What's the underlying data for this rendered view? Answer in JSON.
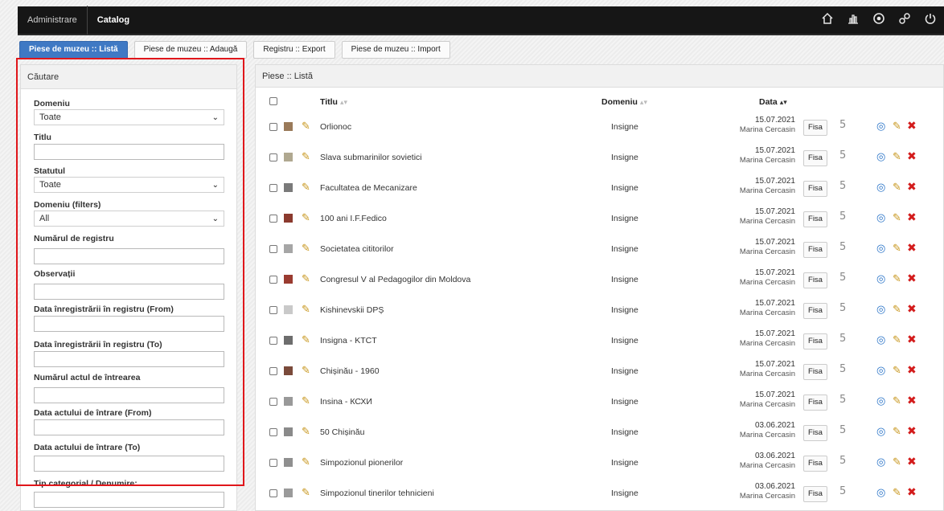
{
  "topbar": {
    "items": [
      "Administrare",
      "Catalog"
    ],
    "icons": [
      "home-icon",
      "stats-icon",
      "settings-icon",
      "link-icon",
      "power-icon"
    ]
  },
  "tabs": [
    {
      "label": "Piese de muzeu :: Listă",
      "active": true
    },
    {
      "label": "Piese de muzeu :: Adaugă",
      "active": false
    },
    {
      "label": "Registru :: Export",
      "active": false
    },
    {
      "label": "Piese de muzeu :: Import",
      "active": false
    }
  ],
  "search": {
    "title": "Căutare",
    "fields": {
      "domeniu": {
        "label": "Domeniu",
        "value": "Toate"
      },
      "titlu": {
        "label": "Titlu",
        "value": ""
      },
      "statutul": {
        "label": "Statutul",
        "value": "Toate"
      },
      "domeniu_filters": {
        "label": "Domeniu (filters)",
        "value": "All"
      },
      "numar_registru": {
        "label": "Numărul de registru",
        "value": ""
      },
      "observatii": {
        "label": "Observații",
        "value": ""
      },
      "data_reg_from": {
        "label": "Data înregistrării în registru (From)",
        "value": ""
      },
      "data_reg_to": {
        "label": "Data înregistrării în registru (To)",
        "value": ""
      },
      "numar_act": {
        "label": "Numărul actul de întrearea",
        "value": ""
      },
      "data_act_from": {
        "label": "Data actului de întrare (From)",
        "value": ""
      },
      "data_act_to": {
        "label": "Data actului de întrare (To)",
        "value": ""
      },
      "tip_categorial": {
        "label": "Tip categorial / Denumire:",
        "value": ""
      }
    }
  },
  "list": {
    "title": "Piese :: Listă",
    "columns": {
      "title": "Titlu",
      "domain": "Domeniu",
      "date": "Data"
    },
    "fisa_label": "Fisa",
    "rows": [
      {
        "title": "Orlionoc",
        "domain": "Insigne",
        "date": "15.07.2021",
        "user": "Marina Cercasin",
        "thumb": "#9a7a5a"
      },
      {
        "title": "Slava submarinilor sovietici",
        "domain": "Insigne",
        "date": "15.07.2021",
        "user": "Marina Cercasin",
        "thumb": "#b0a890"
      },
      {
        "title": "Facultatea de Mecanizare",
        "domain": "Insigne",
        "date": "15.07.2021",
        "user": "Marina Cercasin",
        "thumb": "#7a7a7a"
      },
      {
        "title": "100 ani I.F.Fedico",
        "domain": "Insigne",
        "date": "15.07.2021",
        "user": "Marina Cercasin",
        "thumb": "#8b3a2e"
      },
      {
        "title": "Societatea cititorilor",
        "domain": "Insigne",
        "date": "15.07.2021",
        "user": "Marina Cercasin",
        "thumb": "#a6a6a6"
      },
      {
        "title": "Congresul V al Pedagogilor din Moldova",
        "domain": "Insigne",
        "date": "15.07.2021",
        "user": "Marina Cercasin",
        "thumb": "#9a3b30"
      },
      {
        "title": "Kishinevskii DPȘ",
        "domain": "Insigne",
        "date": "15.07.2021",
        "user": "Marina Cercasin",
        "thumb": "#c9c9c9"
      },
      {
        "title": "Insigna - KTCT",
        "domain": "Insigne",
        "date": "15.07.2021",
        "user": "Marina Cercasin",
        "thumb": "#6d6d6d"
      },
      {
        "title": "Chișinău - 1960",
        "domain": "Insigne",
        "date": "15.07.2021",
        "user": "Marina Cercasin",
        "thumb": "#7a4a3a"
      },
      {
        "title": "Insina - КСХИ",
        "domain": "Insigne",
        "date": "15.07.2021",
        "user": "Marina Cercasin",
        "thumb": "#999999"
      },
      {
        "title": "50 Chișinău",
        "domain": "Insigne",
        "date": "03.06.2021",
        "user": "Marina Cercasin",
        "thumb": "#8a8a8a"
      },
      {
        "title": "Simpozionul pionerilor",
        "domain": "Insigne",
        "date": "03.06.2021",
        "user": "Marina Cercasin",
        "thumb": "#8f8f8f"
      },
      {
        "title": "Simpozionul tinerilor tehnicieni",
        "domain": "Insigne",
        "date": "03.06.2021",
        "user": "Marina Cercasin",
        "thumb": "#9a9a9a"
      }
    ]
  },
  "colors": {
    "accent": "#3f79c4",
    "highlight": "#e0161b",
    "delete": "#d31b1b",
    "view": "#2a74c8",
    "edit": "#c7951a"
  }
}
